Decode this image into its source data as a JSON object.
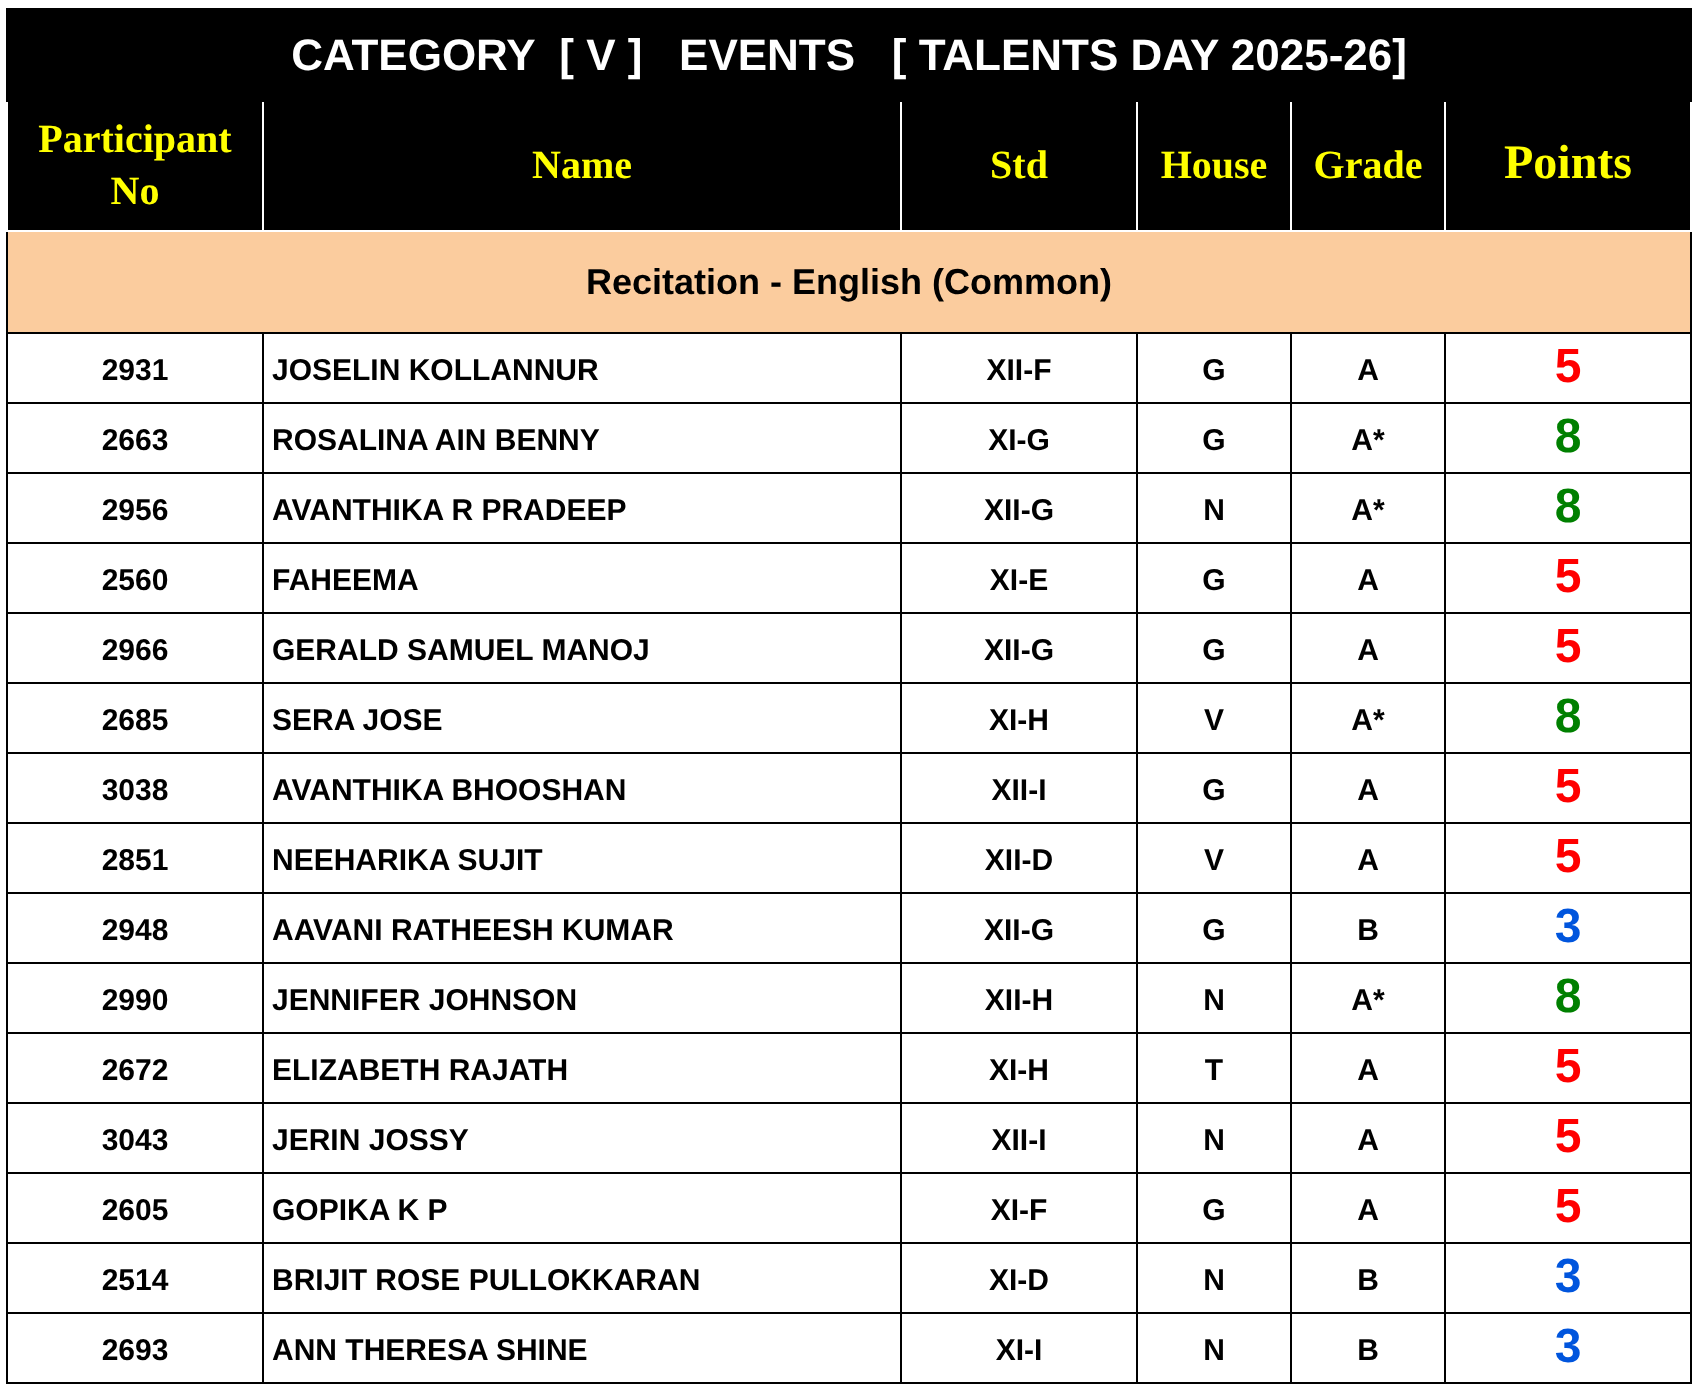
{
  "title": "CATEGORY  [ V ]   EVENTS   [ TALENTS DAY 2025-26]",
  "columns": [
    "Participant No",
    "Name",
    "Std",
    "House",
    "Grade",
    "Points"
  ],
  "section": "Recitation - English (Common)",
  "rows": [
    {
      "no": "2931",
      "name": "JOSELIN KOLLANNUR",
      "std": "XII-F",
      "house": "G",
      "grade": "A",
      "points": "5",
      "color": "#ff0000"
    },
    {
      "no": "2663",
      "name": "ROSALINA AIN BENNY",
      "std": "XI-G",
      "house": "G",
      "grade": "A*",
      "points": "8",
      "color": "#008000"
    },
    {
      "no": "2956",
      "name": "AVANTHIKA R PRADEEP",
      "std": "XII-G",
      "house": "N",
      "grade": "A*",
      "points": "8",
      "color": "#008000"
    },
    {
      "no": "2560",
      "name": "FAHEEMA",
      "std": "XI-E",
      "house": "G",
      "grade": "A",
      "points": "5",
      "color": "#ff0000"
    },
    {
      "no": "2966",
      "name": "GERALD SAMUEL MANOJ",
      "std": "XII-G",
      "house": "G",
      "grade": "A",
      "points": "5",
      "color": "#ff0000"
    },
    {
      "no": "2685",
      "name": "SERA JOSE",
      "std": "XI-H",
      "house": "V",
      "grade": "A*",
      "points": "8",
      "color": "#008000"
    },
    {
      "no": "3038",
      "name": "AVANTHIKA BHOOSHAN",
      "std": "XII-I",
      "house": "G",
      "grade": "A",
      "points": "5",
      "color": "#ff0000"
    },
    {
      "no": "2851",
      "name": "NEEHARIKA SUJIT",
      "std": "XII-D",
      "house": "V",
      "grade": "A",
      "points": "5",
      "color": "#ff0000"
    },
    {
      "no": "2948",
      "name": "AAVANI RATHEESH KUMAR",
      "std": "XII-G",
      "house": "G",
      "grade": "B",
      "points": "3",
      "color": "#0055dd"
    },
    {
      "no": "2990",
      "name": "JENNIFER JOHNSON",
      "std": "XII-H",
      "house": "N",
      "grade": "A*",
      "points": "8",
      "color": "#008000"
    },
    {
      "no": "2672",
      "name": "ELIZABETH RAJATH",
      "std": "XI-H",
      "house": "T",
      "grade": "A",
      "points": "5",
      "color": "#ff0000"
    },
    {
      "no": "3043",
      "name": "JERIN JOSSY",
      "std": "XII-I",
      "house": "N",
      "grade": "A",
      "points": "5",
      "color": "#ff0000"
    },
    {
      "no": "2605",
      "name": "GOPIKA K P",
      "std": "XI-F",
      "house": "G",
      "grade": "A",
      "points": "5",
      "color": "#ff0000"
    },
    {
      "no": "2514",
      "name": "BRIJIT ROSE PULLOKKARAN",
      "std": "XI-D",
      "house": "N",
      "grade": "B",
      "points": "3",
      "color": "#0055dd"
    },
    {
      "no": "2693",
      "name": "ANN THERESA SHINE",
      "std": "XI-I",
      "house": "N",
      "grade": "B",
      "points": "3",
      "color": "#0055dd"
    }
  ]
}
